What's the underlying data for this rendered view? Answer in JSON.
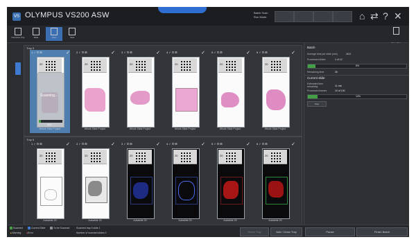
{
  "app": {
    "title": "OLYMPUS VS200 ASW",
    "logo_text": "VS",
    "batch_info": [
      "Batch Scan",
      "Run Mode"
    ],
    "window_buttons": [
      "⌂",
      "⇄",
      "?",
      "✕"
    ]
  },
  "toolbar": {
    "tools": [
      {
        "label": "Overview Tray"
      },
      {
        "label": "Slide"
      },
      {
        "label": "Scan"
      },
      {
        "label": "View"
      }
    ],
    "close_tray_label": "Close Tray"
  },
  "trays": [
    {
      "label": "Tray 5",
      "slots": [
        {
          "head": "1 ✓ ⊡ ⊞",
          "caption": "Whole Slide Project",
          "labelnum": "20",
          "scanning": true,
          "scan_text": "Scanning...",
          "progress_pct": 0.1,
          "progress_text": "10%",
          "tissue": "faint",
          "checked": true
        },
        {
          "head": "2 ✓ ⊡ ⊞",
          "caption": "Whole Slide Project",
          "labelnum": "20",
          "scanning": false,
          "tissue": "pink-large",
          "checked": true
        },
        {
          "head": "3 ✓ ⊡ ⊞",
          "caption": "Whole Slide Project",
          "labelnum": "20",
          "scanning": false,
          "tissue": "pink-small",
          "checked": true
        },
        {
          "head": "4 ✓ ⊡ ⊞",
          "caption": "Whole Slide Project",
          "labelnum": "20",
          "scanning": false,
          "tissue": "pink-wide",
          "checked": true
        },
        {
          "head": "5 ✓ ⊡ ⊞",
          "caption": "Whole Slide Project",
          "labelnum": "20",
          "scanning": false,
          "tissue": "pink-blob",
          "checked": true
        },
        {
          "head": "6 ✓ ⊡ ⊞",
          "caption": "Whole Slide Project",
          "labelnum": "20",
          "scanning": false,
          "tissue": "pink-medium",
          "checked": true
        }
      ]
    },
    {
      "label": "Tray 6",
      "slots": [
        {
          "head": "1 ✓ ⊡ ⊞",
          "caption": "Autoslide 20",
          "labelnum": "20",
          "scanning": false,
          "tissue": "grey-faint",
          "checked": true
        },
        {
          "head": "2 ✓ ⊡ ⊞",
          "caption": "Autoslide 20",
          "labelnum": "20",
          "scanning": false,
          "tissue": "grey-dark",
          "checked": true
        },
        {
          "head": "3 ✓ ⊡ ⊞",
          "caption": "Autoslide 20",
          "labelnum": "20",
          "scanning": false,
          "tissue": "blue",
          "checked": true
        },
        {
          "head": "4 ✓ ⊡ ⊞",
          "caption": "Autoslide 20",
          "labelnum": "20",
          "scanning": false,
          "tissue": "blue-outline",
          "checked": true
        },
        {
          "head": "5 ✓ ⊡ ⊞",
          "caption": "Autoslide 20",
          "labelnum": "20",
          "scanning": false,
          "tissue": "red",
          "checked": true
        },
        {
          "head": "6 ✓ ⊡ ⊞",
          "caption": "Autoslide 20",
          "labelnum": "20",
          "scanning": false,
          "tissue": "red-green",
          "checked": true
        }
      ]
    }
  ],
  "right_panel": {
    "batch_heading": "Batch",
    "batch_rows": [
      {
        "label": "Average time per slide (min)",
        "value": "15.0"
      },
      {
        "label": "Processed slides",
        "value": "1 of 12"
      }
    ],
    "batch_progress_pct": 0.08,
    "batch_progress_text": "8%",
    "remaining_label": "Remaining time",
    "remaining_value": "3h",
    "current_heading": "Current slide",
    "current_rows": [
      {
        "label": "Estimated time remaining",
        "value": "11 min"
      },
      {
        "label": "Processed frames",
        "value": "10 of 100"
      }
    ],
    "current_progress_pct": 0.1,
    "current_progress_text": "10%",
    "action_label": "Stop"
  },
  "statusbar": {
    "legend": [
      {
        "text": "Scanned",
        "color": "#43a047"
      },
      {
        "text": "Current Slide",
        "color": "#3d7ad0"
      },
      {
        "text": "To be Scanned",
        "color": "#8a8f96"
      }
    ],
    "info_lines": [
      "Scanned tray 5 slide 1",
      "Number of scanned slides 0"
    ],
    "warning": "Warning",
    "error": "Error",
    "buttons": {
      "reset_tray": "Reset Tray",
      "add_tray": "Add / Close Tray",
      "pause": "Pause",
      "stop_batch": "Finish Batch"
    }
  },
  "colors": {
    "accent": "#3d7ad0",
    "selected_slot": "#4f7fae",
    "progress": "#43a047"
  }
}
